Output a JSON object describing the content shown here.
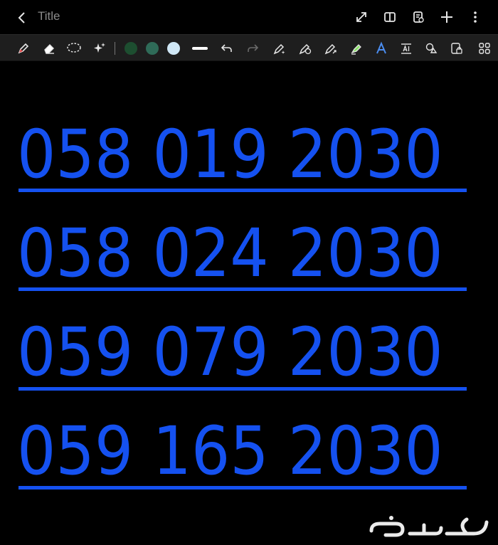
{
  "header": {
    "title": "Title"
  },
  "colors": {
    "ink": "#1551f0",
    "swatch_1": "#1d4e30",
    "swatch_2": "#2f6b58",
    "swatch_3": "#cfe7f5"
  },
  "toolbar": {
    "tools": [
      "pen-icon",
      "eraser-icon",
      "lasso-icon",
      "sparkle-icon",
      "undo-icon",
      "redo-icon",
      "pen-sparkle-icon",
      "pen-clock-icon",
      "pen-arrow-icon",
      "highlighter-icon",
      "text-style-icon",
      "text-box-icon",
      "shapes-icon",
      "lock-page-icon",
      "grid-icon"
    ]
  },
  "phone_numbers": [
    "058 019 2030",
    "058 024 2030",
    "059 079 2030",
    "059 165 2030"
  ],
  "watermark": "حراج"
}
